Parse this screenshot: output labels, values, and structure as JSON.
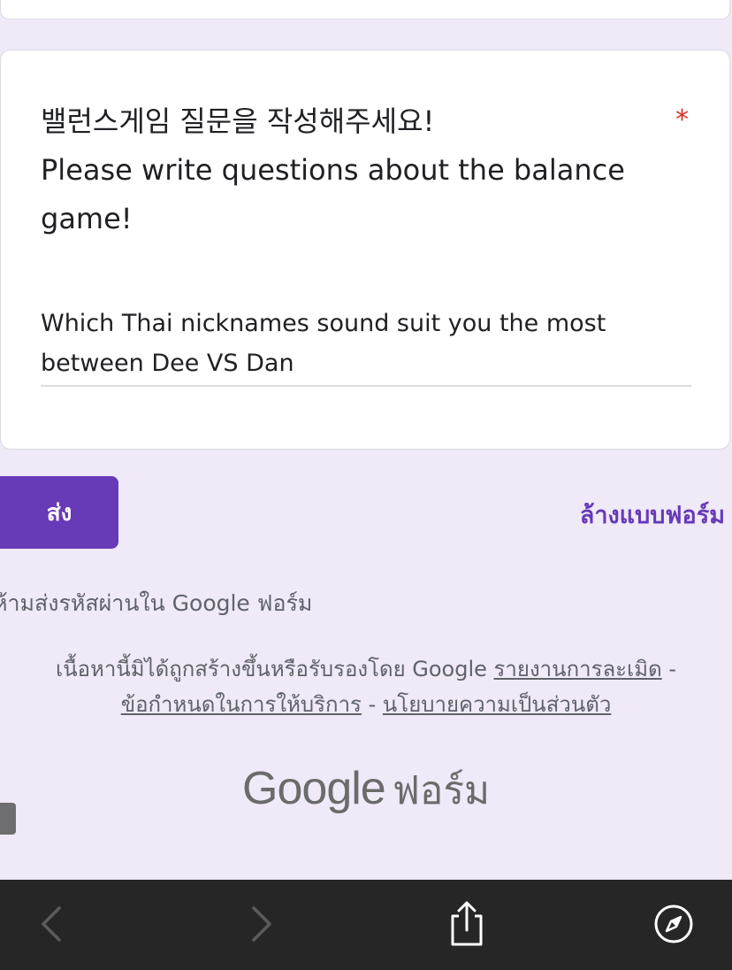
{
  "form": {
    "question_title_line1": "밸런스게임 질문을 작성해주세요!",
    "question_title_line2": "Please write questions about the balance game!",
    "required_mark": "*",
    "answer_text": "Which Thai nicknames sound suit you the most between Dee VS Dan"
  },
  "actions": {
    "submit_label": "ส่ง",
    "clear_form_label": "ล้างแบบฟอร์ม"
  },
  "footer": {
    "password_warning": "ห้ามส่งรหัสผ่านใน Google ฟอร์ม",
    "disclaimer": "เนื้อหานี้มิได้ถูกสร้างขึ้นหรือรับรองโดย Google",
    "report_abuse": "รายงานการละเมิด",
    "separator": "-",
    "terms_of_service": "ข้อกำหนดในการให้บริการ",
    "privacy_policy": "นโยบายความเป็นส่วนตัว",
    "logo_google": "Google",
    "logo_forms": "ฟอร์ม"
  },
  "toolbar": {
    "icons": [
      "back-icon",
      "forward-icon",
      "share-icon",
      "compass-icon"
    ]
  },
  "colors": {
    "accent": "#673ab7",
    "background": "#efe9f8",
    "required": "#d93025",
    "toolbar": "#262626"
  }
}
